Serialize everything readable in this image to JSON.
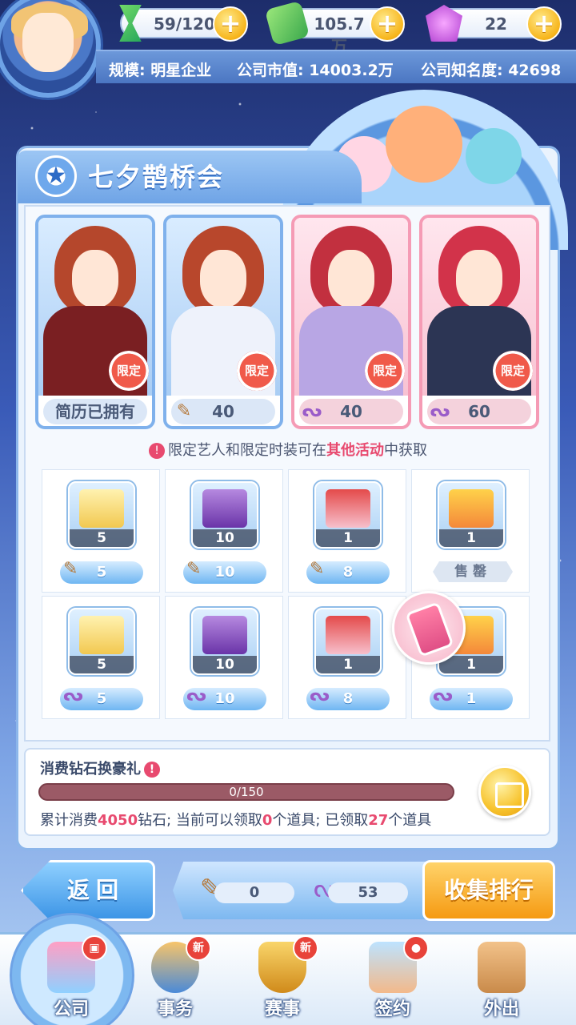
{
  "resources": {
    "energy": "59/120",
    "cash": "105.7万",
    "diamond": "22"
  },
  "company": {
    "scale": "规模: 明星企业",
    "market_value": "公司市值: 14003.2万",
    "fame": "公司知名度: 42698"
  },
  "event": {
    "title": "七夕鹊桥会",
    "cards": [
      {
        "badge": "限定",
        "cost": "简历已拥有",
        "currency": ""
      },
      {
        "badge": "限定",
        "cost": "40",
        "currency": "scroll-icon"
      },
      {
        "badge": "限定",
        "cost": "40",
        "currency": "ribbon-icon"
      },
      {
        "badge": "限定",
        "cost": "60",
        "currency": "ribbon-icon"
      }
    ],
    "notice_pre": "限定艺人和限定时装可在",
    "notice_em": "其他活动",
    "notice_post": "中获取",
    "items_row1": [
      {
        "qty": "5",
        "price": "5",
        "currency": "scroll-icon"
      },
      {
        "qty": "10",
        "price": "10",
        "currency": "scroll-icon"
      },
      {
        "qty": "1",
        "price": "8",
        "currency": "scroll-icon"
      },
      {
        "qty": "1",
        "sold": "售罄"
      }
    ],
    "items_row2": [
      {
        "qty": "5",
        "price": "5",
        "currency": "ribbon-icon"
      },
      {
        "qty": "10",
        "price": "10",
        "currency": "ribbon-icon"
      },
      {
        "qty": "1",
        "price": "8",
        "currency": "ribbon-icon"
      },
      {
        "qty": "1",
        "price": "1",
        "currency": "ribbon-icon"
      }
    ]
  },
  "progress": {
    "title": "消费钻石换豪礼",
    "value": "0/150",
    "ratio": 0,
    "desc_a": "累计消费",
    "desc_b": "4050",
    "desc_c": "钻石; 当前可以领取",
    "desc_d": "0",
    "desc_e": "个道具; 已领取",
    "desc_f": "27",
    "desc_g": "个道具"
  },
  "actions": {
    "back": "返回",
    "scroll_count": "0",
    "ribbon_count": "53",
    "rank": "收集排行"
  },
  "nav": [
    {
      "label": "公司",
      "badge": "gift-icon"
    },
    {
      "label": "事务",
      "badge": "新"
    },
    {
      "label": "赛事",
      "badge": "新"
    },
    {
      "label": "签约",
      "badge": "person-icon"
    },
    {
      "label": "外出",
      "badge": ""
    }
  ]
}
